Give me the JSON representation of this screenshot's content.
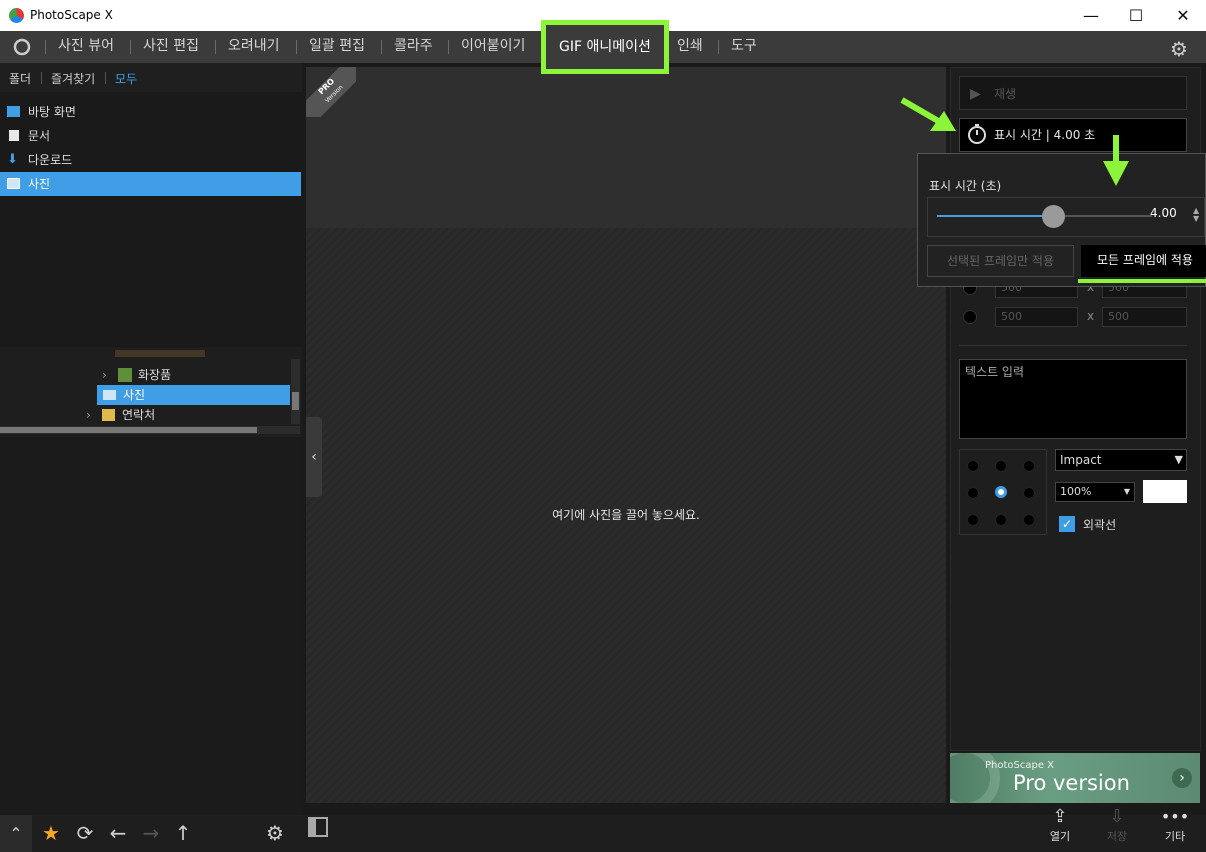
{
  "window": {
    "title": "PhotoScape X",
    "minimize": "—",
    "maximize": "☐",
    "close": "✕"
  },
  "menu": {
    "items": [
      "사진 뷰어",
      "사진 편집",
      "오려내기",
      "일괄 편집",
      "콜라주",
      "이어붙이기"
    ],
    "active": "GIF 애니메이션",
    "items_after": [
      "인쇄",
      "도구"
    ]
  },
  "sidebar": {
    "tabs": [
      "폴더",
      "즐겨찾기",
      "모두"
    ],
    "active_tab": "모두",
    "folders": [
      {
        "label": "바탕 화면",
        "icon": "desktop-icon"
      },
      {
        "label": "문서",
        "icon": "document-icon"
      },
      {
        "label": "다운로드",
        "icon": "download-icon"
      },
      {
        "label": "사진",
        "icon": "pictures-icon",
        "selected": true
      }
    ],
    "tree": [
      {
        "label": "화장품"
      },
      {
        "label": "사진",
        "selected": true
      },
      {
        "label": "연락처"
      }
    ]
  },
  "center": {
    "badge_line1": "PRO",
    "badge_line2": "Version",
    "drop_hint": "여기에 사진을 끌어 놓으세요."
  },
  "right": {
    "play_label": "재생",
    "display_time_label": "표시 시간 | 4.00 초",
    "popup": {
      "title": "표시 시간 (초)",
      "value": "4.00",
      "slider_fraction": 0.5,
      "apply_selected": "선택된 프레임만 적용",
      "apply_all": "모든 프레임에 적용"
    },
    "size_a": "500",
    "size_b": "500",
    "x_sep": "x",
    "text_placeholder": "텍스트 입력",
    "font": "Impact",
    "opacity": "100%",
    "outline_label": "외곽선",
    "promo_line1": "PhotoScape X",
    "promo_line2": "Pro version"
  },
  "bottom": {
    "open": "열기",
    "save": "저장",
    "more": "기타"
  },
  "colors": {
    "accent": "#3f9ee5",
    "highlight": "#8cf53a"
  }
}
